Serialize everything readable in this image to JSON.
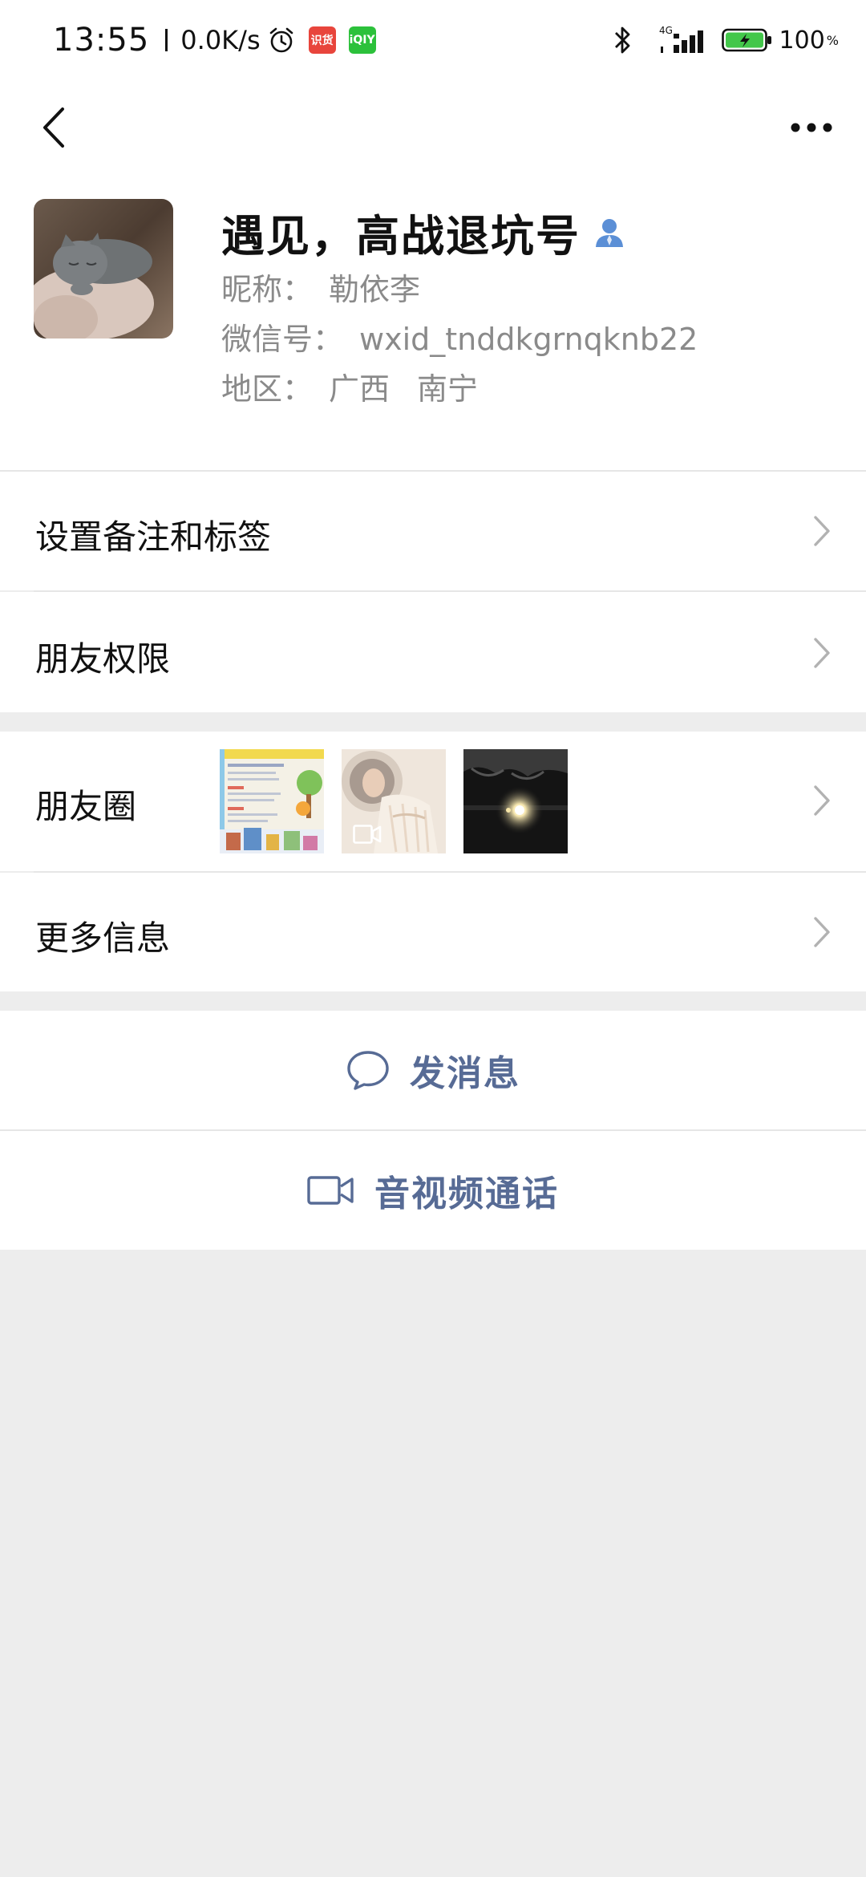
{
  "status_bar": {
    "time": "13:55",
    "net_speed": "0.0K/s",
    "app_badge_1": "识货",
    "app_badge_2": "iQIY",
    "network_type": "4G",
    "battery": "100",
    "battery_unit": "%",
    "colors": {
      "badge_red": "#e8453c",
      "badge_green": "#2cc13b",
      "battery_green": "#43c74a"
    }
  },
  "topnav": {
    "back_icon": "chevron-left-icon",
    "more_icon": "more-dots-icon"
  },
  "profile": {
    "name": "遇见，高战退坑号",
    "nickname_label": "昵称：",
    "nickname": "勒依李",
    "wxid_label": "微信号：",
    "wxid": "wxid_tnddkgrnqknb22",
    "region_label": "地区：",
    "region_province": "广西",
    "region_city": "南宁",
    "avatar_desc_icon": "avatar-cat-photo",
    "verified_icon": "person-icon"
  },
  "cells": {
    "remark": "设置备注和标签",
    "permissions": "朋友权限",
    "moments": "朋友圈",
    "more_info": "更多信息"
  },
  "actions": {
    "message": "发消息",
    "message_icon": "chat-bubble-icon",
    "call": "音视频通话",
    "call_icon": "video-camera-icon",
    "accent_color": "#576b95"
  }
}
